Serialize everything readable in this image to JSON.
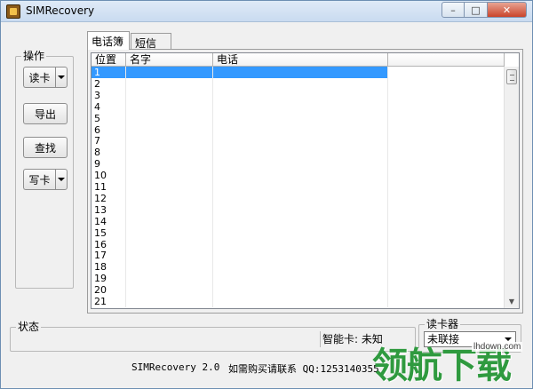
{
  "window": {
    "title": "SIMRecovery"
  },
  "operations": {
    "group_label": "操作",
    "read_card": "读卡",
    "export": "导出",
    "find": "查找",
    "write_card": "写卡"
  },
  "tabs": [
    {
      "label": "电话簿",
      "active": true
    },
    {
      "label": "短信",
      "active": false
    }
  ],
  "phonebook": {
    "columns": [
      "位置",
      "名字",
      "电话"
    ],
    "rows": [
      {
        "pos": "1",
        "name": "",
        "phone": ""
      },
      {
        "pos": "2",
        "name": "",
        "phone": ""
      },
      {
        "pos": "3",
        "name": "",
        "phone": ""
      },
      {
        "pos": "4",
        "name": "",
        "phone": ""
      },
      {
        "pos": "5",
        "name": "",
        "phone": ""
      },
      {
        "pos": "6",
        "name": "",
        "phone": ""
      },
      {
        "pos": "7",
        "name": "",
        "phone": ""
      },
      {
        "pos": "8",
        "name": "",
        "phone": ""
      },
      {
        "pos": "9",
        "name": "",
        "phone": ""
      },
      {
        "pos": "10",
        "name": "",
        "phone": ""
      },
      {
        "pos": "11",
        "name": "",
        "phone": ""
      },
      {
        "pos": "12",
        "name": "",
        "phone": ""
      },
      {
        "pos": "13",
        "name": "",
        "phone": ""
      },
      {
        "pos": "14",
        "name": "",
        "phone": ""
      },
      {
        "pos": "15",
        "name": "",
        "phone": ""
      },
      {
        "pos": "16",
        "name": "",
        "phone": ""
      },
      {
        "pos": "17",
        "name": "",
        "phone": ""
      },
      {
        "pos": "18",
        "name": "",
        "phone": ""
      },
      {
        "pos": "19",
        "name": "",
        "phone": ""
      },
      {
        "pos": "20",
        "name": "",
        "phone": ""
      },
      {
        "pos": "21",
        "name": "",
        "phone": ""
      }
    ],
    "selected_row": "1"
  },
  "status": {
    "group_label": "状态",
    "smart_card": "智能卡: 未知"
  },
  "reader": {
    "group_label": "读卡器",
    "selected": "未联接"
  },
  "footer": {
    "version": "SIMRecovery 2.0",
    "contact": "如需购买请联系 QQ:1253140355"
  },
  "watermark": {
    "url": "lhdown.com",
    "text": "领航下载"
  },
  "colors": {
    "selection": "#3399ff",
    "watermark": "#2f9a3f"
  }
}
